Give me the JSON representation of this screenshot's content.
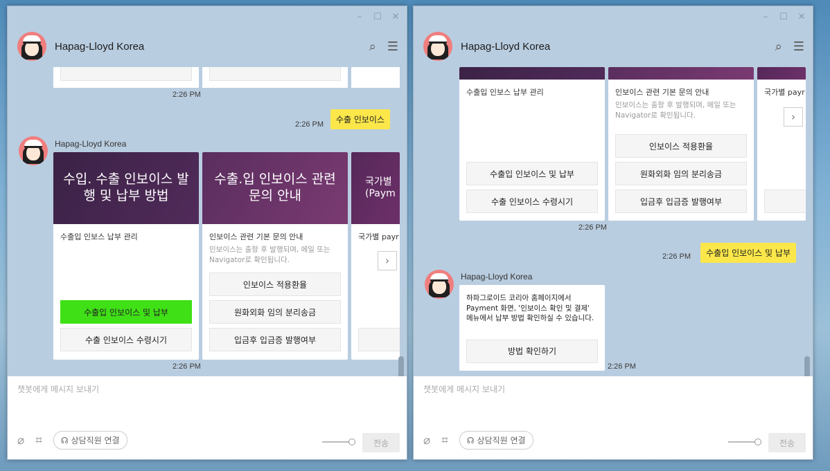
{
  "window": {
    "title": "Hapag-Lloyd Korea",
    "controls": [
      "–",
      "☐",
      "✕"
    ]
  },
  "left": {
    "top_time": "2:26 PM",
    "user_msg": "수출 인보이스",
    "user_time": "2:26 PM",
    "sender": "Hapag-Lloyd Korea",
    "cards": [
      {
        "banner": "수입. 수출 인보이스 발행 및 납부 방법",
        "title": "수출입 인보스 납부 관리",
        "desc": "",
        "buttons": [
          "수출입 인보이스 및 납부",
          "수출 인보이스 수령시기"
        ]
      },
      {
        "banner": "수출.입 인보이스 관련 문의 안내",
        "title": "인보이스 관련 기본 문의 안내",
        "desc": "인보이스는 출항 후 발행되며, 메일 또는 Navigator로 확인됩니다.",
        "buttons": [
          "인보이스 적용환율",
          "원화외화 임의 분리송금",
          "입금후 입금증 발행여부"
        ]
      },
      {
        "banner": "국가별 (Paym",
        "title": "국가별 payr",
        "buttons": [
          "",
          ""
        ]
      }
    ],
    "cards_time": "2:26 PM",
    "placeholder": "챗봇에게 메시지 보내기",
    "agent_label": "상담직원 연결",
    "send_label": "전송"
  },
  "right": {
    "cards": [
      {
        "title": "수출입 인보스 납부 관리",
        "buttons": [
          "수출입 인보이스 및 납부",
          "수출 인보이스 수령시기"
        ]
      },
      {
        "title": "인보이스 관련 기본 문의 안내",
        "desc": "인보이스는 출항 후 발행되며, 메일 또는 Navigator로 확인됩니다.",
        "buttons": [
          "인보이스 적용환율",
          "원화외화 임의 분리송금",
          "입금후 입금증 발행여부"
        ]
      },
      {
        "title": "국가별 payr"
      }
    ],
    "cards_time": "2:26 PM",
    "user_msg": "수출입 인보이스 및 납부",
    "user_time": "2:26 PM",
    "sender": "Hapag-Lloyd Korea",
    "bot_msg": "하파그로이드 코리아 홈페이지에서 Payment 화면, '인보이스 확인 및 결제' 메뉴에서 납부 방법 확인하실 수 있습니다.",
    "bot_button": "방법 확인하기",
    "bot_time": "2:26 PM",
    "placeholder": "챗봇에게 메시지 보내기",
    "agent_label": "상담직원 연결",
    "send_label": "전송"
  }
}
